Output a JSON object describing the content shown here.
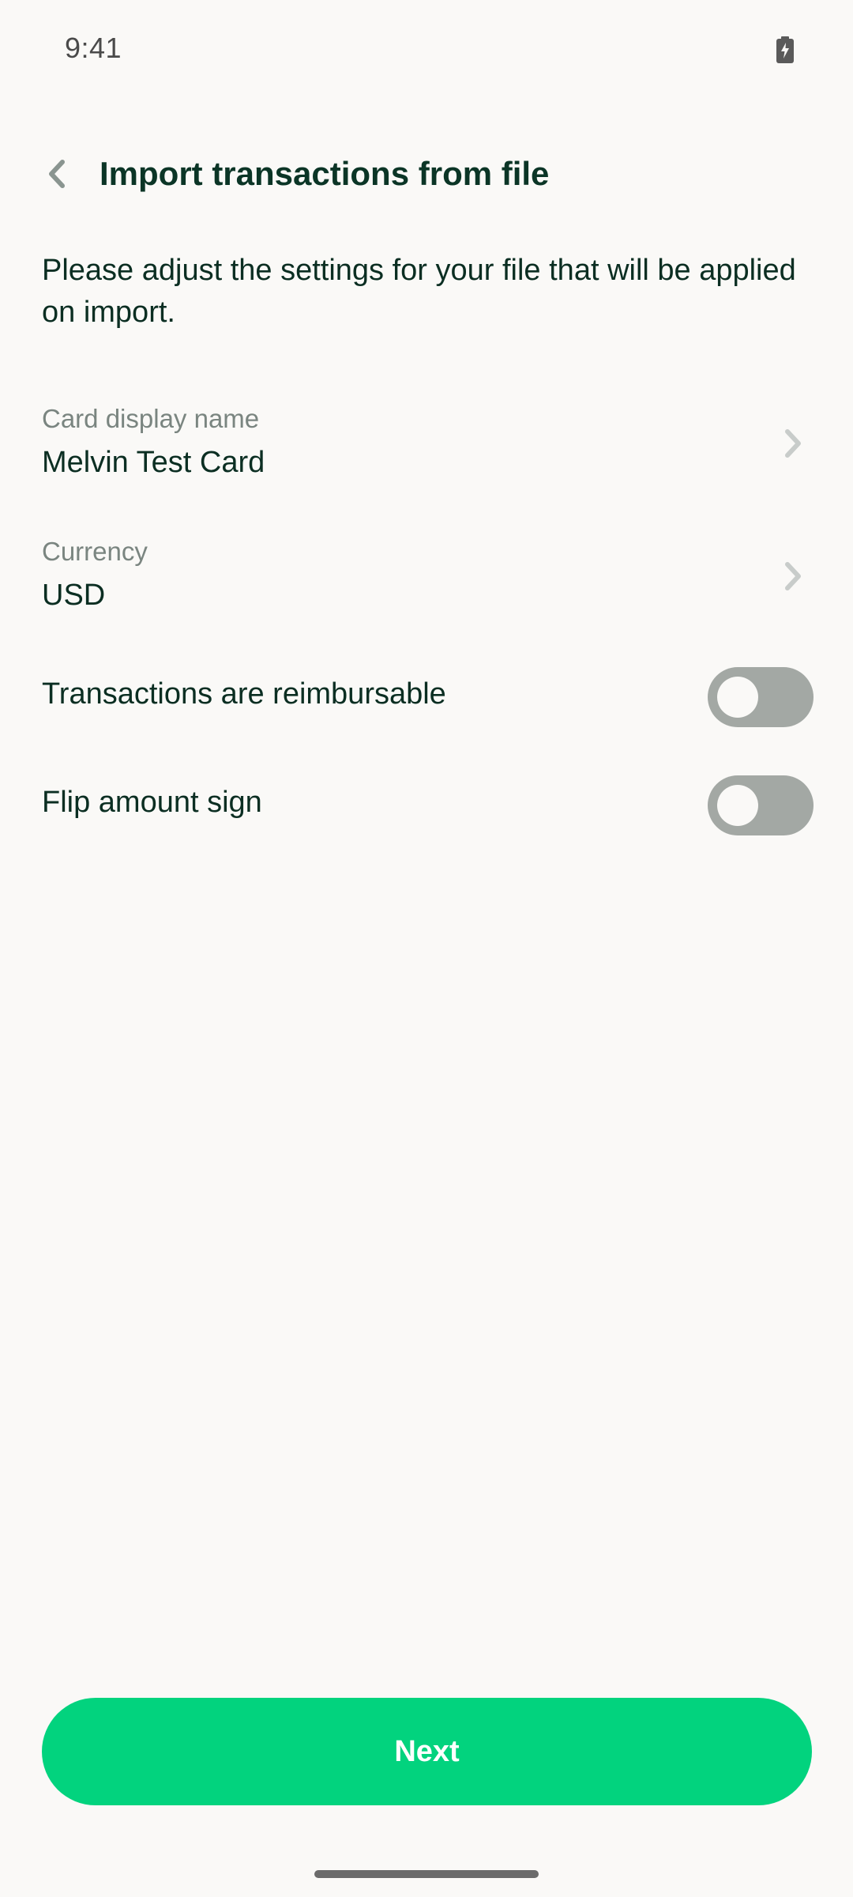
{
  "status_bar": {
    "time": "9:41",
    "battery_icon": "battery-charging-icon"
  },
  "header": {
    "back_icon": "chevron-left-icon",
    "title": "Import transactions from file"
  },
  "intro_text": "Please adjust the settings for your file that will be applied on import.",
  "settings": {
    "card_name": {
      "label": "Card display name",
      "value": "Melvin Test Card",
      "icon": "chevron-right-icon"
    },
    "currency": {
      "label": "Currency",
      "value": "USD",
      "icon": "chevron-right-icon"
    },
    "reimbursable": {
      "label": "Transactions are reimbursable",
      "enabled": false
    },
    "flip_sign": {
      "label": "Flip amount sign",
      "enabled": false
    }
  },
  "next_button": {
    "label": "Next"
  },
  "colors": {
    "accent": "#02D37E",
    "background": "#FAF9F7",
    "title": "#0B3526",
    "toggle_off": "#A3A8A4"
  }
}
